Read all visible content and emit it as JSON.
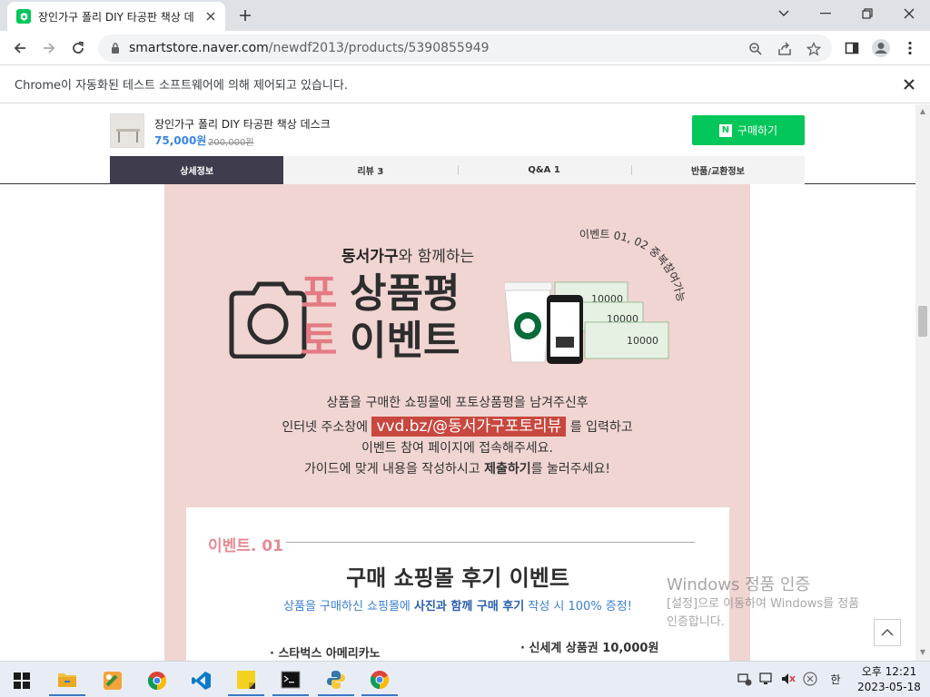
{
  "browser": {
    "tab_title": "장인가구 폴리 DIY 타공판 책상 데",
    "url_host": "smartstore.naver.com",
    "url_path": "/newdf2013/products/5390855949",
    "infobar_text": "Chrome이 자동화된 테스트 소프트웨어에 의해 제어되고 있습니다."
  },
  "product": {
    "name": "장인가구 폴리 DIY 타공판 책상 데스크",
    "price": "75,000원",
    "original_price": "200,000원",
    "buy_label": "구매하기",
    "buy_logo": "N"
  },
  "tabs": [
    {
      "label": "상세정보"
    },
    {
      "label": "리뷰 3"
    },
    {
      "label": "Q&A 1"
    },
    {
      "label": "반품/교환정보"
    }
  ],
  "event": {
    "sub_brand": "동서가구",
    "sub_rest": "와 함께하는",
    "char_po": "포",
    "char_to": "토",
    "line1": "상품평",
    "line2": "이벤트",
    "curved_text": "이벤트 01, 02 중복참여가능",
    "bill_value": "10000",
    "desc1": "상품을 구매한 쇼핑몰에 포토상품평을 남겨주신후",
    "desc2_pre": "인터넷 주소창에 ",
    "desc2_hl": "vvd.bz/@동서가구포토리뷰",
    "desc2_post": " 를 입력하고",
    "desc3": "이벤트 참여 페이지에 접속해주세요.",
    "desc4_pre": "가이드에 맞게 내용을 작성하시고 ",
    "desc4_bold": "제출하기",
    "desc4_post": "를 눌러주세요!",
    "ev1_label": "이벤트. 01",
    "ev1_title": "구매 쇼핑몰 후기 이벤트",
    "ev1_sub_pre": "상품을 구매하신 쇼핑몰에 ",
    "ev1_sub_bold": "사진과 함께 구매 후기",
    "ev1_sub_post": " 작성 시 100% 증정!",
    "gift1": "· 스타벅스 아메리카노",
    "gift2": "· 신세계 상품권 10,000원"
  },
  "watermark": {
    "title": "Windows 정품 인증",
    "line1": "[설정]으로 이동하여 Windows를 정품",
    "line2": "인증합니다."
  },
  "taskbar": {
    "ime": "한",
    "time": "오후 12:21",
    "date": "2023-05-18"
  },
  "colors": {
    "naver_green": "#03c75a",
    "banner_pink": "#f0d5d2",
    "accent_pink": "#e47b84",
    "highlight_red": "#c8483f",
    "tab_active": "#3e3c4d"
  }
}
